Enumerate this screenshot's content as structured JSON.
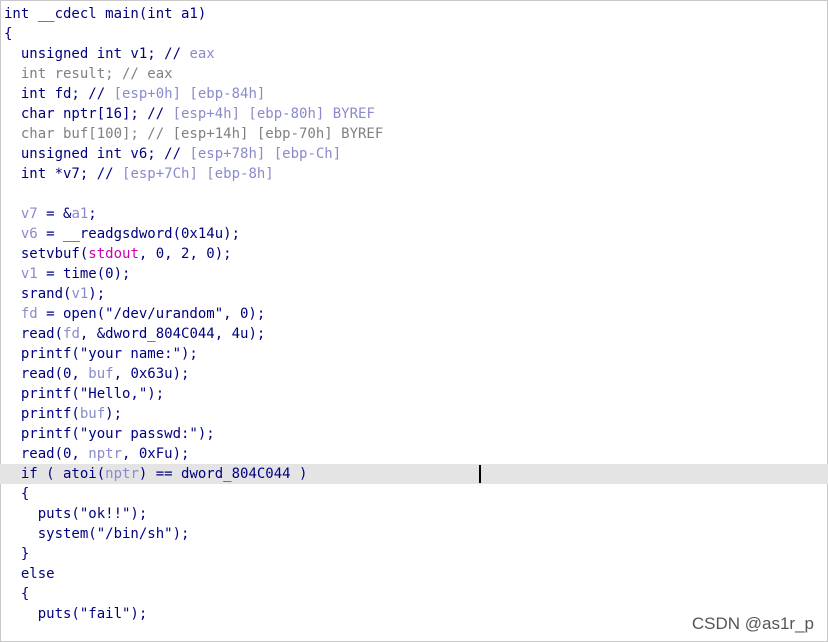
{
  "colors": {
    "code": "#000080",
    "gray": "#808080",
    "var": "#8a8acc",
    "symbol": "#cc00aa",
    "highlight": "#e4e4e4"
  },
  "code_lines": [
    [
      {
        "t": "int __cdecl main(int a1)",
        "c": "code"
      }
    ],
    [
      {
        "t": "{",
        "c": "code"
      }
    ],
    [
      {
        "t": "  unsigned int v1; // ",
        "c": "code"
      },
      {
        "t": "eax",
        "c": "var"
      }
    ],
    [
      {
        "t": "  int result; // eax",
        "c": "gray"
      }
    ],
    [
      {
        "t": "  int fd; // ",
        "c": "code"
      },
      {
        "t": "[esp+0h] [ebp-84h]",
        "c": "var"
      }
    ],
    [
      {
        "t": "  char nptr[16]; // ",
        "c": "code"
      },
      {
        "t": "[esp+4h] [ebp-80h] BYREF",
        "c": "var"
      }
    ],
    [
      {
        "t": "  char buf[100]; // [esp+14h] [ebp-70h] BYREF",
        "c": "gray"
      }
    ],
    [
      {
        "t": "  unsigned int v6; // ",
        "c": "code"
      },
      {
        "t": "[esp+78h] [ebp-Ch]",
        "c": "var"
      }
    ],
    [
      {
        "t": "  int *v7; // ",
        "c": "code"
      },
      {
        "t": "[esp+7Ch] [ebp-8h]",
        "c": "var"
      }
    ],
    [
      {
        "t": "",
        "c": "code"
      }
    ],
    [
      {
        "t": "  ",
        "c": "code"
      },
      {
        "t": "v7",
        "c": "var"
      },
      {
        "t": " = &",
        "c": "code"
      },
      {
        "t": "a1",
        "c": "var"
      },
      {
        "t": ";",
        "c": "code"
      }
    ],
    [
      {
        "t": "  ",
        "c": "code"
      },
      {
        "t": "v6",
        "c": "var"
      },
      {
        "t": " = __readgsdword(0x14u);",
        "c": "code"
      }
    ],
    [
      {
        "t": "  setvbuf(",
        "c": "code"
      },
      {
        "t": "stdout",
        "c": "sym"
      },
      {
        "t": ", 0, 2, 0);",
        "c": "code"
      }
    ],
    [
      {
        "t": "  ",
        "c": "code"
      },
      {
        "t": "v1",
        "c": "var"
      },
      {
        "t": " = time(0);",
        "c": "code"
      }
    ],
    [
      {
        "t": "  srand(",
        "c": "code"
      },
      {
        "t": "v1",
        "c": "var"
      },
      {
        "t": ");",
        "c": "code"
      }
    ],
    [
      {
        "t": "  ",
        "c": "code"
      },
      {
        "t": "fd",
        "c": "var"
      },
      {
        "t": " = open(\"/dev/urandom\", 0);",
        "c": "code"
      }
    ],
    [
      {
        "t": "  read(",
        "c": "code"
      },
      {
        "t": "fd",
        "c": "var"
      },
      {
        "t": ", &dword_804C044, 4u);",
        "c": "code"
      }
    ],
    [
      {
        "t": "  printf(\"your name:\");",
        "c": "code"
      }
    ],
    [
      {
        "t": "  read(0, ",
        "c": "code"
      },
      {
        "t": "buf",
        "c": "var"
      },
      {
        "t": ", 0x63u);",
        "c": "code"
      }
    ],
    [
      {
        "t": "  printf(\"Hello,\");",
        "c": "code"
      }
    ],
    [
      {
        "t": "  printf(",
        "c": "code"
      },
      {
        "t": "buf",
        "c": "var"
      },
      {
        "t": ");",
        "c": "code"
      }
    ],
    [
      {
        "t": "  printf(\"your passwd:\");",
        "c": "code"
      }
    ],
    [
      {
        "t": "  read(0, ",
        "c": "code"
      },
      {
        "t": "nptr",
        "c": "var"
      },
      {
        "t": ", 0xFu);",
        "c": "code"
      }
    ],
    [
      {
        "t": "  if ( atoi(",
        "c": "code"
      },
      {
        "t": "nptr",
        "c": "var"
      },
      {
        "t": ") == dword_804C044 )",
        "c": "code"
      }
    ],
    [
      {
        "t": "  {",
        "c": "code"
      }
    ],
    [
      {
        "t": "    puts(\"ok!!\");",
        "c": "code"
      }
    ],
    [
      {
        "t": "    system(\"/bin/sh\");",
        "c": "code"
      }
    ],
    [
      {
        "t": "  }",
        "c": "code"
      }
    ],
    [
      {
        "t": "  else",
        "c": "code"
      }
    ],
    [
      {
        "t": "  {",
        "c": "code"
      }
    ],
    [
      {
        "t": "    puts(\"fail\");",
        "c": "code"
      }
    ]
  ],
  "highlighted_line": 23,
  "watermark": "CSDN @as1r_p"
}
